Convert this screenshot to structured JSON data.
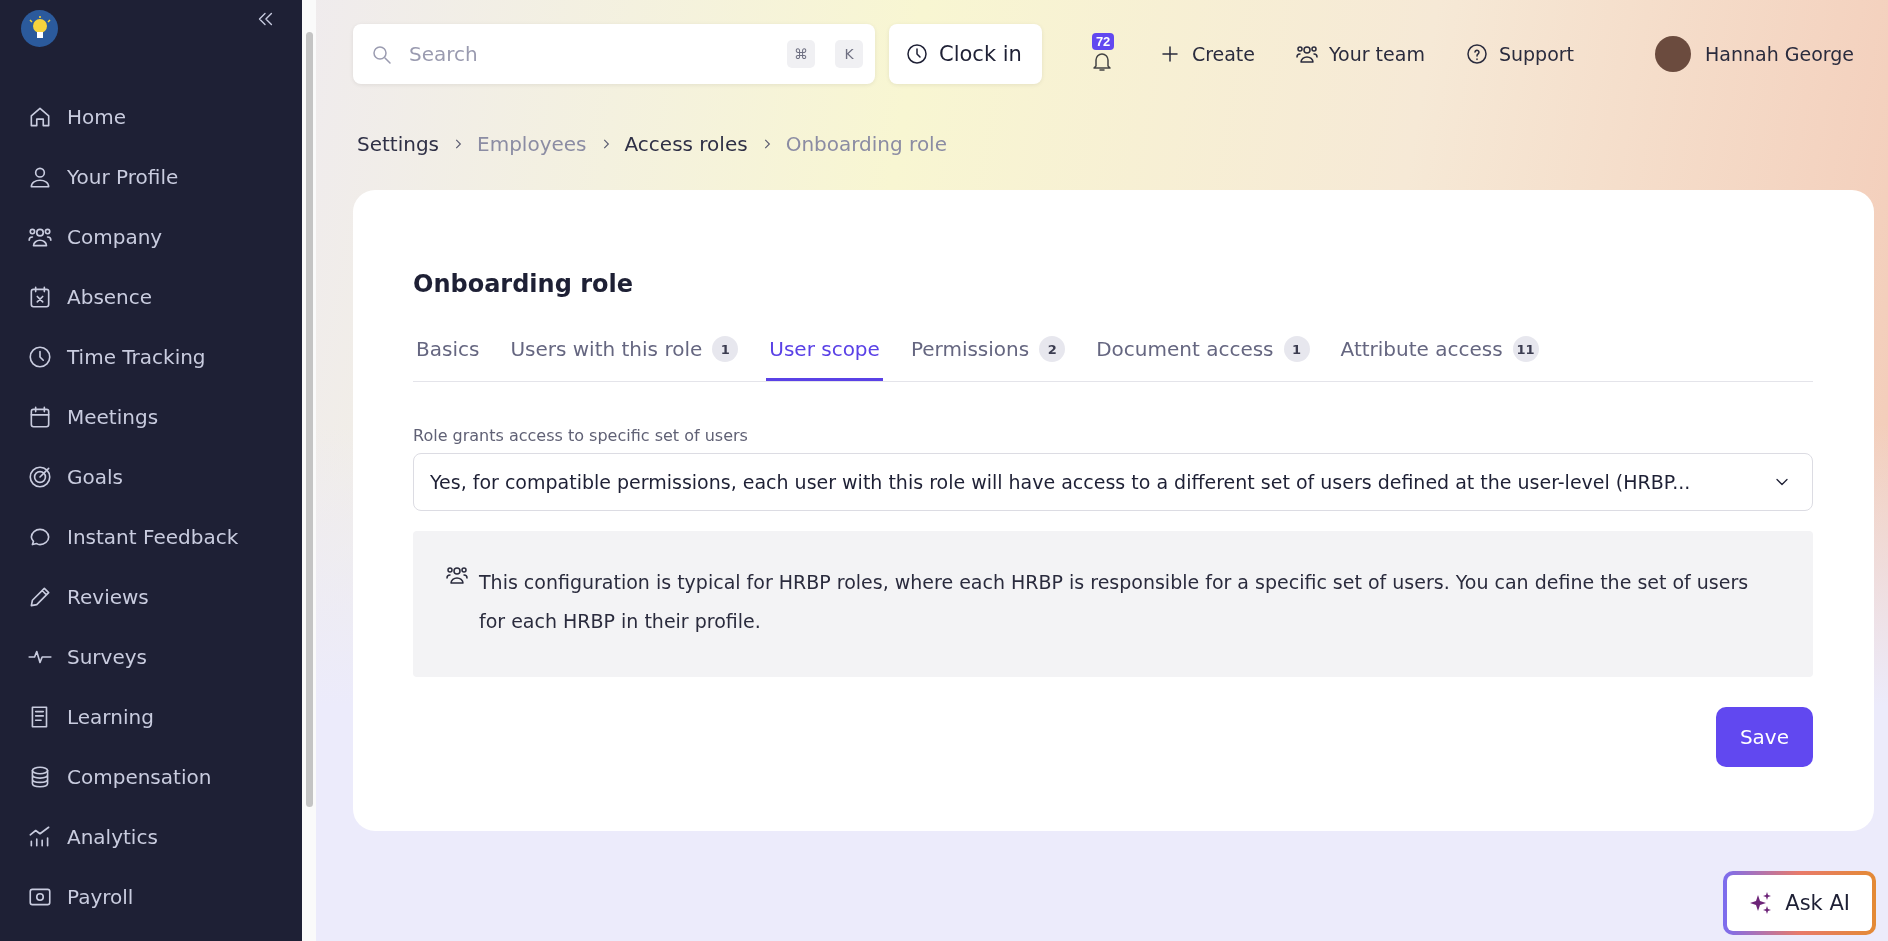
{
  "sidebar": {
    "items": [
      {
        "label": "Home"
      },
      {
        "label": "Your Profile"
      },
      {
        "label": "Company"
      },
      {
        "label": "Absence"
      },
      {
        "label": "Time Tracking"
      },
      {
        "label": "Meetings"
      },
      {
        "label": "Goals"
      },
      {
        "label": "Instant Feedback"
      },
      {
        "label": "Reviews"
      },
      {
        "label": "Surveys"
      },
      {
        "label": "Learning"
      },
      {
        "label": "Compensation"
      },
      {
        "label": "Analytics"
      },
      {
        "label": "Payroll"
      }
    ]
  },
  "top_bar": {
    "search": {
      "placeholder": "Search",
      "shortcut": [
        "⌘",
        "K"
      ]
    },
    "clock_in": "Clock in",
    "notifications": "72",
    "actions": [
      {
        "label": "Create"
      },
      {
        "label": "Your team"
      },
      {
        "label": "Support"
      }
    ],
    "user": "Hannah George"
  },
  "breadcrumb": [
    {
      "label": "Settings",
      "muted": false
    },
    {
      "label": "Employees",
      "muted": true
    },
    {
      "label": "Access roles",
      "muted": false
    },
    {
      "label": "Onboarding role",
      "muted": true
    }
  ],
  "card": {
    "title": "Onboarding role",
    "tabs": [
      {
        "label": "Basics",
        "selected": false
      },
      {
        "label": "Users with this role",
        "count": "1",
        "selected": false
      },
      {
        "label": "User scope",
        "selected": true
      },
      {
        "label": "Permissions",
        "count": "2",
        "selected": false
      },
      {
        "label": "Document access",
        "count": "1",
        "selected": false
      },
      {
        "label": "Attribute access",
        "count": "11",
        "selected": false
      }
    ],
    "field_label": "Role grants access to specific set of users",
    "select_value": "Yes, for compatible permissions, each user with this role will have access to a different set of users defined at the user-level (HRBP...",
    "info": "This configuration is typical for HRBP roles, where each HRBP is responsible for a specific set of users. You can define the set of users for each HRBP in their profile.",
    "save": "Save"
  },
  "ask_ai": "Ask AI"
}
